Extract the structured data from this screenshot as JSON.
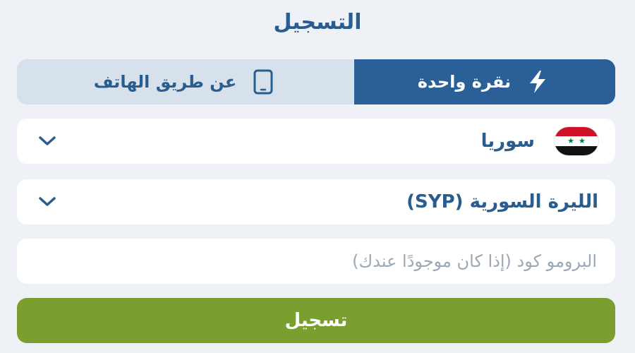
{
  "page": {
    "title": "التسجيل"
  },
  "tabs": [
    {
      "label": "نقرة واحدة",
      "icon": "lightning-icon",
      "active": true
    },
    {
      "label": "عن طريق الهاتف",
      "icon": "phone-icon",
      "active": false
    }
  ],
  "country": {
    "value": "سوريا",
    "flag": "syria-flag-icon"
  },
  "currency": {
    "value": "الليرة السورية (SYP)"
  },
  "promo": {
    "placeholder": "البرومو كود (إذا كان موجودًا عندك)",
    "value": ""
  },
  "register": {
    "label": "تسجيل"
  },
  "colors": {
    "background": "#eef2f7",
    "primary_blue": "#2a5f98",
    "inactive_tab": "#d7e1ec",
    "text_blue": "#2a5d8f",
    "placeholder": "#9aa9b8",
    "register_green": "#7a9f2f"
  }
}
